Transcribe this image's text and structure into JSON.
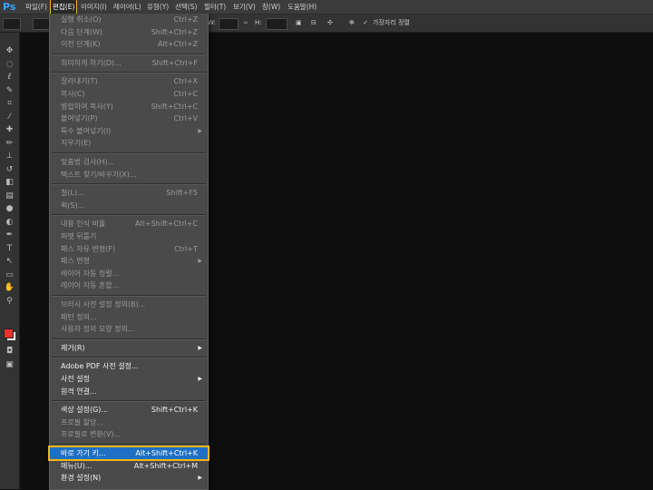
{
  "app_logo": "Ps",
  "menubar": [
    "파일(F)",
    "편집(E)",
    "이미지(I)",
    "레이어(L)",
    "유형(Y)",
    "선택(S)",
    "필터(T)",
    "보기(V)",
    "창(W)",
    "도움말(H)"
  ],
  "options": {
    "w_label": "W:",
    "h_label": "H:",
    "align_edges": "가장자리 정렬"
  },
  "edit_menu": [
    {
      "label": "실행 취소(O)",
      "shortcut": "Ctrl+Z",
      "enabled": false
    },
    {
      "label": "다음 단계(W)",
      "shortcut": "Shift+Ctrl+Z",
      "enabled": false
    },
    {
      "label": "이전 단계(K)",
      "shortcut": "Alt+Ctrl+Z",
      "enabled": false
    },
    {
      "sep": true
    },
    {
      "label": "희미하게 하기(D)...",
      "shortcut": "Shift+Ctrl+F",
      "enabled": false
    },
    {
      "sep": true
    },
    {
      "label": "잘라내기(T)",
      "shortcut": "Ctrl+X",
      "enabled": false
    },
    {
      "label": "복사(C)",
      "shortcut": "Ctrl+C",
      "enabled": false
    },
    {
      "label": "병합하여 복사(Y)",
      "shortcut": "Shift+Ctrl+C",
      "enabled": false
    },
    {
      "label": "붙여넣기(P)",
      "shortcut": "Ctrl+V",
      "enabled": false
    },
    {
      "label": "특수 붙여넣기(I)",
      "shortcut": "",
      "arrow": true,
      "enabled": false
    },
    {
      "label": "지우기(E)",
      "shortcut": "",
      "enabled": false
    },
    {
      "sep": true
    },
    {
      "label": "맞춤법 검사(H)...",
      "shortcut": "",
      "enabled": false
    },
    {
      "label": "텍스트 찾기/바꾸기(X)...",
      "shortcut": "",
      "enabled": false
    },
    {
      "sep": true
    },
    {
      "label": "칠(L)...",
      "shortcut": "Shift+F5",
      "enabled": false
    },
    {
      "label": "획(S)...",
      "shortcut": "",
      "enabled": false
    },
    {
      "sep": true
    },
    {
      "label": "내용 인식 비율",
      "shortcut": "Alt+Shift+Ctrl+C",
      "enabled": false
    },
    {
      "label": "퍼펫 뒤틀기",
      "shortcut": "",
      "enabled": false
    },
    {
      "label": "패스 자유 변형(F)",
      "shortcut": "Ctrl+T",
      "enabled": false
    },
    {
      "label": "패스 변형",
      "shortcut": "",
      "arrow": true,
      "enabled": false
    },
    {
      "label": "레이어 자동 정렬...",
      "shortcut": "",
      "enabled": false
    },
    {
      "label": "레이어 자동 혼합...",
      "shortcut": "",
      "enabled": false
    },
    {
      "sep": true
    },
    {
      "label": "브러시 사전 설정 정의(B)...",
      "shortcut": "",
      "enabled": false
    },
    {
      "label": "패턴 정의...",
      "shortcut": "",
      "enabled": false
    },
    {
      "label": "사용자 정의 모양 정의...",
      "shortcut": "",
      "enabled": false
    },
    {
      "sep": true
    },
    {
      "label": "제거(R)",
      "shortcut": "",
      "arrow": true,
      "enabled": true
    },
    {
      "sep": true
    },
    {
      "label": "Adobe PDF 사전 설정...",
      "shortcut": "",
      "enabled": true
    },
    {
      "label": "사전 설정",
      "shortcut": "",
      "arrow": true,
      "enabled": true
    },
    {
      "label": "원격 연결...",
      "shortcut": "",
      "enabled": true
    },
    {
      "sep": true
    },
    {
      "label": "색상 설정(G)...",
      "shortcut": "Shift+Ctrl+K",
      "enabled": true
    },
    {
      "label": "프로필 할당...",
      "shortcut": "",
      "enabled": false
    },
    {
      "label": "프로필로 변환(V)...",
      "shortcut": "",
      "enabled": false
    },
    {
      "sep": true
    },
    {
      "label": "바로 가기 키...",
      "shortcut": "Alt+Shift+Ctrl+K",
      "enabled": true,
      "highlighted": true
    },
    {
      "label": "메뉴(U)...",
      "shortcut": "Alt+Shift+Ctrl+M",
      "enabled": true
    },
    {
      "label": "환경 설정(N)",
      "shortcut": "",
      "arrow": true,
      "enabled": true
    }
  ],
  "colors": {
    "foreground": "#e8322a",
    "background": "#ffffff",
    "highlight": "#1f6fc5",
    "accent_outline": "#f3b51a"
  }
}
